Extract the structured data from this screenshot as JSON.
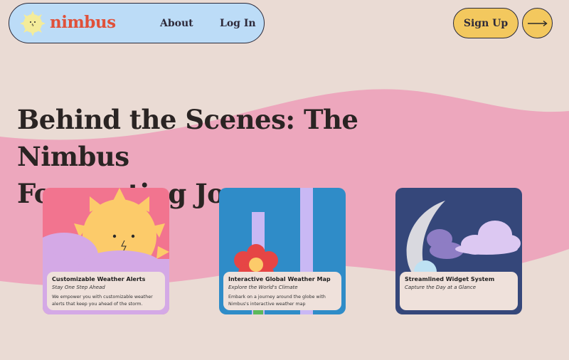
{
  "header": {
    "logo_text": "nimbus",
    "nav": [
      {
        "label": "About"
      },
      {
        "label": "Log In"
      }
    ],
    "signup_label": "Sign Up",
    "arrow_icon": "arrow-right-icon"
  },
  "hero": {
    "headline_line1": "Behind the Scenes: The Nimbus",
    "headline_line2": "Forecasting Journey"
  },
  "cards": [
    {
      "title": "Customizable Weather Alerts",
      "subtitle": "Stay One Step Ahead",
      "description": "We empower you with customizable weather alerts that keep you ahead of the storm.",
      "illustration": "sun-face-icon"
    },
    {
      "title": "Interactive Global Weather Map",
      "subtitle": "Explore the World's Climate",
      "description": "Embark on a journey around the globe with Nimbus's interactive weather map",
      "illustration": "flower-icon"
    },
    {
      "title": "Streamlined Widget System",
      "subtitle": "Capture the Day at a Glance",
      "description": "",
      "illustration": "moon-cloud-icon"
    }
  ],
  "colors": {
    "background": "#eadbd4",
    "wave_pink": "#eda7bd",
    "nav_blue": "#bcdcf7",
    "logo_red": "#e0513a",
    "button_yellow": "#f3c85e",
    "card1_bg": "#f2748f",
    "card2_bg": "#2f8cc8",
    "card3_bg": "#35477a"
  }
}
